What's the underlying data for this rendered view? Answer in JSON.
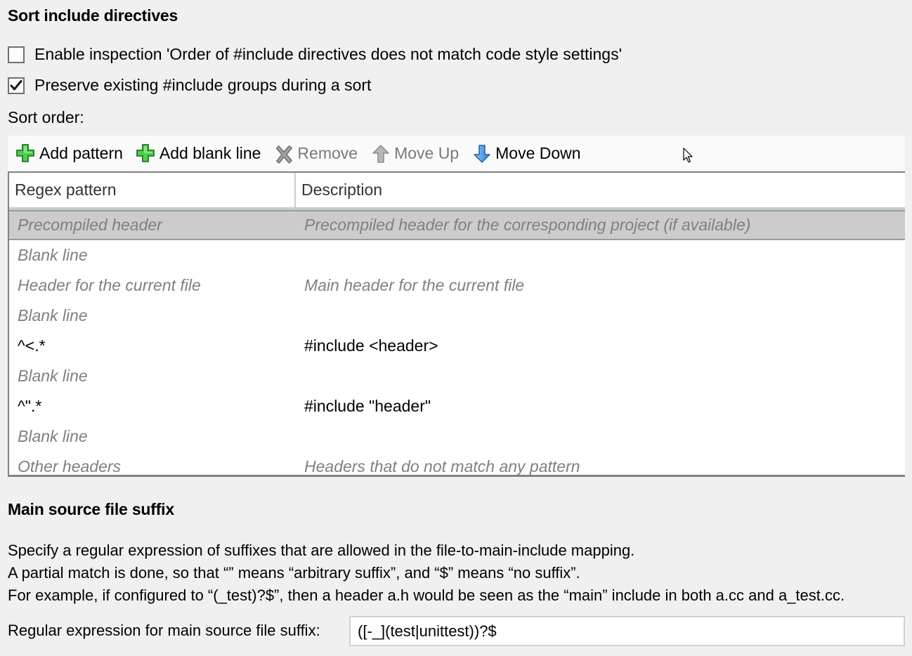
{
  "sort_section": {
    "title": "Sort include directives",
    "options": [
      {
        "label": "Enable inspection 'Order of #include directives does not match code style settings'",
        "checked": false
      },
      {
        "label": "Preserve existing #include groups during a sort",
        "checked": true
      }
    ],
    "sort_order_label": "Sort order:"
  },
  "toolbar": {
    "buttons": [
      {
        "label": "Add pattern",
        "icon": "plus-icon",
        "enabled": true
      },
      {
        "label": "Add blank line",
        "icon": "plus-icon",
        "enabled": true
      },
      {
        "label": "Remove",
        "icon": "remove-x-icon",
        "enabled": false
      },
      {
        "label": "Move Up",
        "icon": "arrow-up-icon",
        "enabled": false
      },
      {
        "label": "Move Down",
        "icon": "arrow-down-icon",
        "enabled": true
      }
    ]
  },
  "table": {
    "columns": [
      "Regex pattern",
      "Description"
    ],
    "rows": [
      {
        "pattern": "Precompiled header",
        "description": "Precompiled header for the corresponding project (if available)",
        "builtin": true,
        "selected": true
      },
      {
        "pattern": "Blank line",
        "description": "",
        "builtin": true,
        "selected": false
      },
      {
        "pattern": "Header for the current file",
        "description": "Main header for the current file",
        "builtin": true,
        "selected": false
      },
      {
        "pattern": "Blank line",
        "description": "",
        "builtin": true,
        "selected": false
      },
      {
        "pattern": "^<.*",
        "description": "#include <header>",
        "builtin": false,
        "selected": false
      },
      {
        "pattern": "Blank line",
        "description": "",
        "builtin": true,
        "selected": false
      },
      {
        "pattern": "^\".*",
        "description": "#include \"header\"",
        "builtin": false,
        "selected": false
      },
      {
        "pattern": "Blank line",
        "description": "",
        "builtin": true,
        "selected": false
      },
      {
        "pattern": "Other headers",
        "description": "Headers that do not match any pattern",
        "builtin": true,
        "selected": false
      }
    ]
  },
  "suffix_section": {
    "title": "Main source file suffix",
    "description_lines": [
      "Specify a regular expression of suffixes that are allowed in the file-to-main-include mapping.",
      "A partial match is done, so that “” means “arbitrary suffix”, and “$” means “no suffix”.",
      "For example, if configured to “(_test)?$”, then a header a.h would be seen as the “main” include in both a.cc and a_test.cc."
    ],
    "input_label": "Regular expression for main source file suffix:",
    "input_value": "([-_](test|unittest))?$"
  },
  "colors": {
    "background": "#f0f0f0",
    "selected_row": "#cccccc",
    "builtin_text": "#808080",
    "disabled_text": "#7a7a7a",
    "plus_green": "#3cc43c",
    "arrow_blue": "#3c8ee6"
  }
}
